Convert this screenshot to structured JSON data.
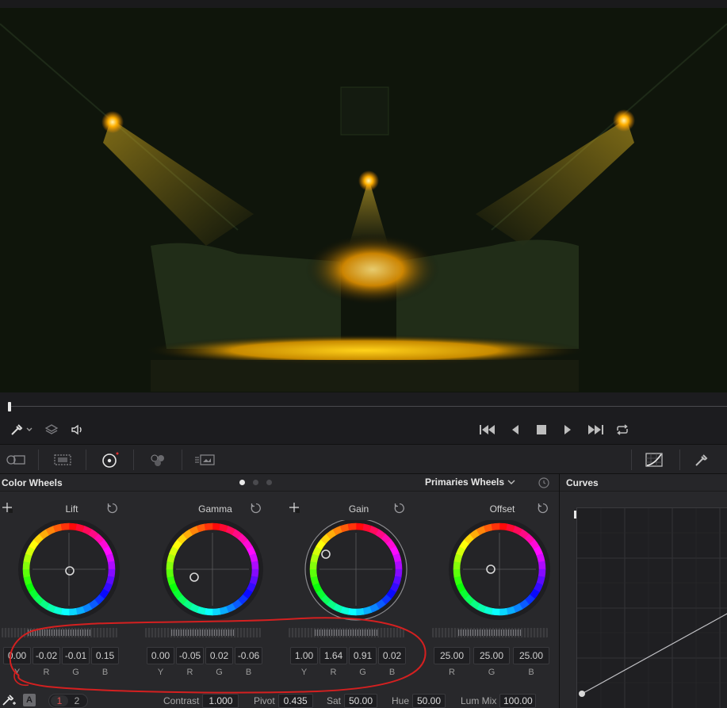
{
  "viewer": {
    "description_icon": "video-frame"
  },
  "transport": {
    "icons": [
      "eyedropper-icon",
      "layers-icon",
      "speaker-icon",
      "skip-start-icon",
      "step-back-icon",
      "stop-icon",
      "play-icon",
      "skip-end-icon",
      "loop-icon"
    ]
  },
  "color_wheels": {
    "title": "Color Wheels",
    "mode": "Primaries Wheels",
    "page_dots": 3,
    "wheels": [
      {
        "label": "Lift",
        "values": [
          "0.00",
          "-0.02",
          "-0.01",
          "0.15"
        ],
        "channels": [
          "Y",
          "R",
          "G",
          "B"
        ],
        "slider_level": 0.5
      },
      {
        "label": "Gamma",
        "values": [
          "0.00",
          "-0.05",
          "0.02",
          "-0.06"
        ],
        "channels": [
          "Y",
          "R",
          "G",
          "B"
        ],
        "slider_level": 0.5
      },
      {
        "label": "Gain",
        "values": [
          "1.00",
          "1.64",
          "0.91",
          "0.02"
        ],
        "channels": [
          "Y",
          "R",
          "G",
          "B"
        ],
        "slider_level": 0.5
      },
      {
        "label": "Offset",
        "values": [
          "25.00",
          "25.00",
          "25.00"
        ],
        "channels": [
          "R",
          "G",
          "B"
        ],
        "slider_level": 0.5
      }
    ],
    "bottom": {
      "auto_label": "A",
      "pages": [
        "1",
        "2"
      ],
      "contrast_label": "Contrast",
      "contrast_value": "1.000",
      "pivot_label": "Pivot",
      "pivot_value": "0.435",
      "sat_label": "Sat",
      "sat_value": "50.00",
      "hue_label": "Hue",
      "hue_value": "50.00",
      "lummix_label": "Lum Mix",
      "lummix_value": "100.00"
    }
  },
  "curves": {
    "title": "Curves"
  },
  "colors": {
    "accent_red": "#d42020",
    "panel": "#28282b",
    "viewer_glow": "#f0a800"
  }
}
